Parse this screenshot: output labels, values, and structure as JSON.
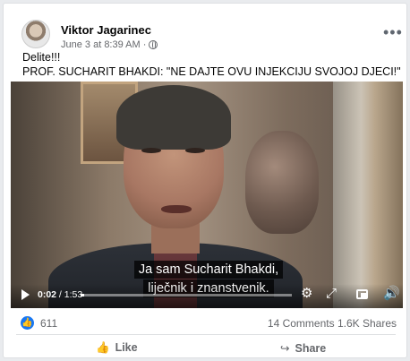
{
  "post": {
    "author": "Viktor Jagarinec",
    "timestamp": "June 3 at 8:39 AM ·",
    "privacy_icon": "globe-icon",
    "more_label": "•••",
    "text_line1": "Delite!!!",
    "text_line2": "PROF. SUCHARIT BHAKDI: \"NE DAJTE OVU INJEKCIJU SVOJOJ DJECI!\""
  },
  "video": {
    "caption_line1": "Ja sam Sucharit Bhakdi,",
    "caption_line2": "liječnik i znanstvenik.",
    "current_time": "0:02",
    "duration": "1:53",
    "time_separator": " / ",
    "progress_fraction": 0.0177
  },
  "stats": {
    "reactions_count": "611",
    "comments": "14 Comments",
    "shares": "1.6K Shares"
  },
  "actions": {
    "like_label": "Like",
    "share_label": "Share"
  }
}
